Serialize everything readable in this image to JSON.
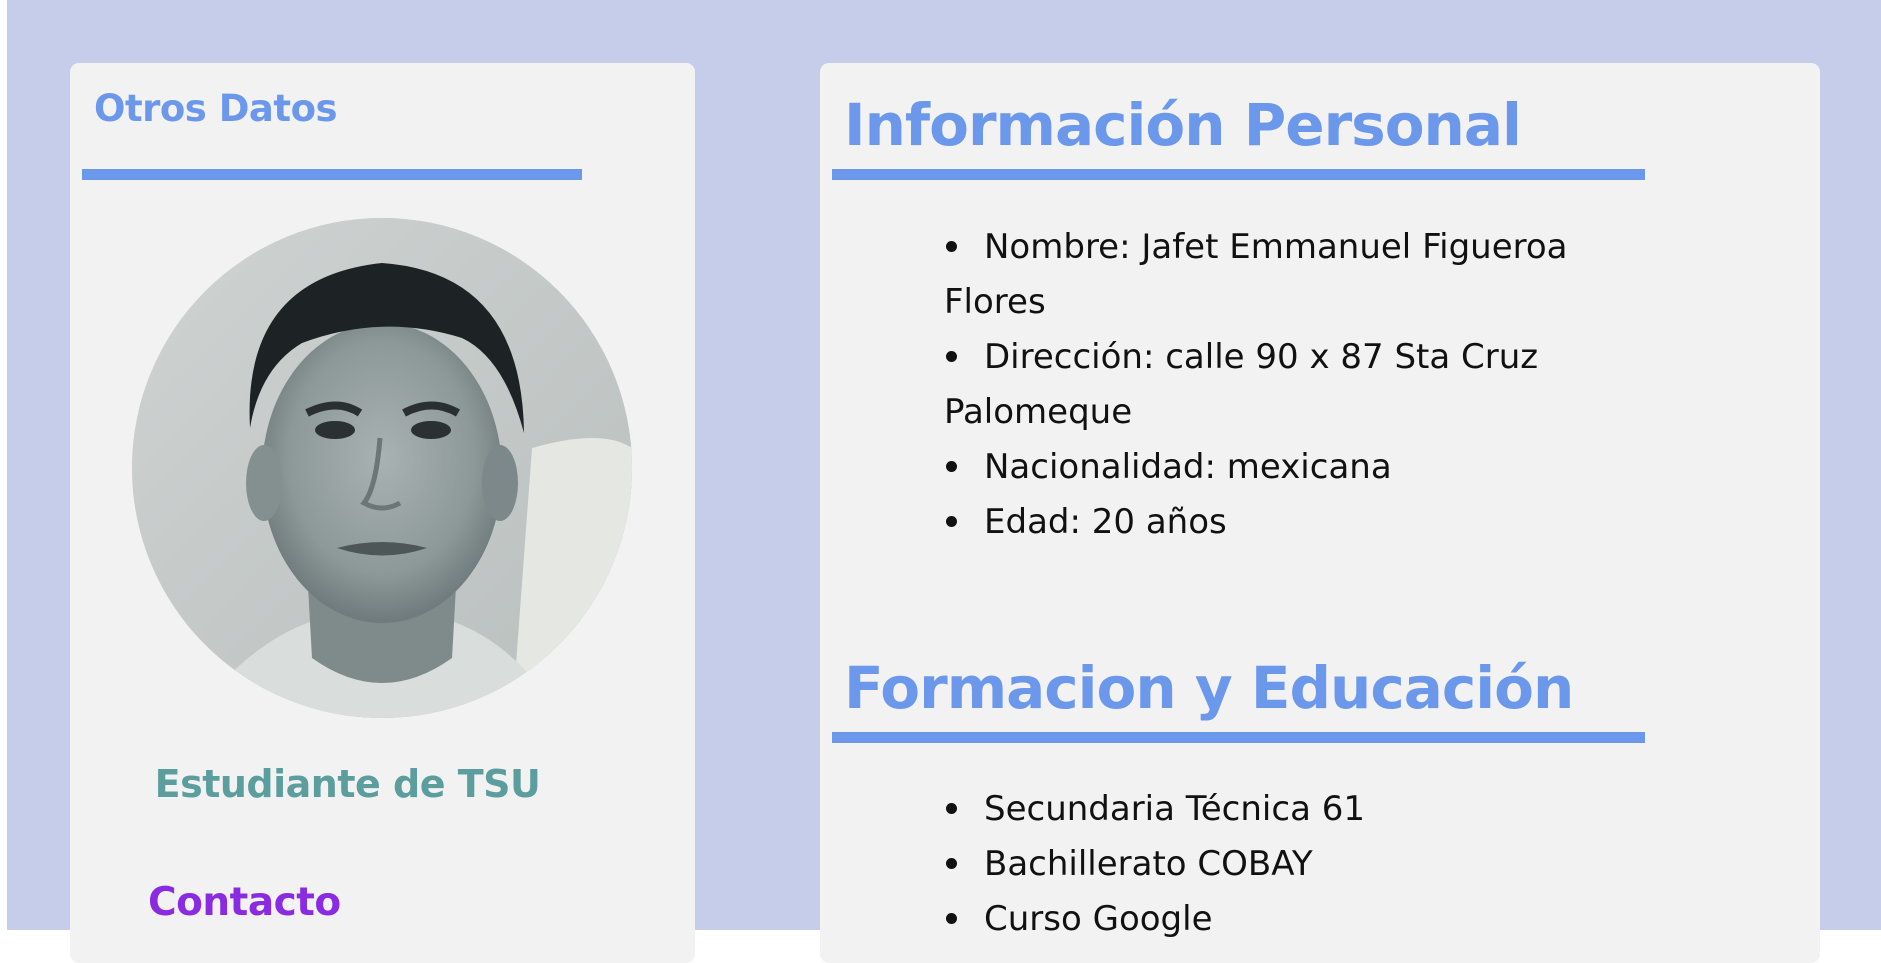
{
  "sidebar": {
    "heading": "Otros Datos",
    "role": "Estudiante de TSU",
    "contact_heading": "Contacto"
  },
  "personal": {
    "title": "Información Personal",
    "items": [
      "Nombre: Jafet Emmanuel Figueroa Flores",
      "Dirección: calle 90 x 87 Sta Cruz Palomeque",
      "Nacionalidad: mexicana",
      "Edad: 20 años"
    ]
  },
  "education": {
    "title": "Formacion y Educación",
    "items": [
      "Secundaria Técnica 61",
      "Bachillerato COBAY",
      "Curso Google"
    ]
  },
  "colors": {
    "background": "#c6cdea",
    "card": "#f2f2f2",
    "accent": "#6c98ec",
    "role": "#5c9e9d",
    "contact": "#8a2be2"
  }
}
